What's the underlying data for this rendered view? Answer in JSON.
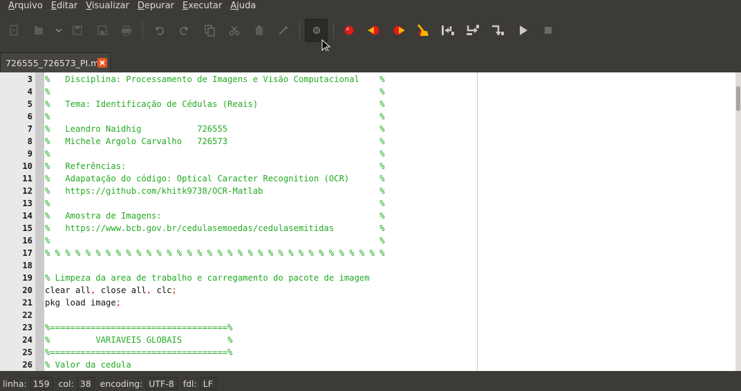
{
  "menu": {
    "items": [
      {
        "label": "Arquivo"
      },
      {
        "label": "Editar"
      },
      {
        "label": "Visualizar"
      },
      {
        "label": "Depurar"
      },
      {
        "label": "Executar"
      },
      {
        "label": "Ajuda"
      }
    ]
  },
  "tab": {
    "title": "726555_726573_PI.m",
    "close_icon": "close-icon"
  },
  "editor": {
    "lines": [
      {
        "n": "3",
        "spans": [
          {
            "t": "%   Disciplina: Processamento de Imagens e Visão Computacional    %",
            "c": "comment"
          }
        ]
      },
      {
        "n": "4",
        "spans": [
          {
            "t": "%                                                                 %",
            "c": "comment"
          }
        ]
      },
      {
        "n": "5",
        "spans": [
          {
            "t": "%   Tema: Identificação de Cédulas (Reais)                        %",
            "c": "comment"
          }
        ]
      },
      {
        "n": "6",
        "spans": [
          {
            "t": "%                                                                 %",
            "c": "comment"
          }
        ]
      },
      {
        "n": "7",
        "spans": [
          {
            "t": "%   Leandro Naidhig           726555                              %",
            "c": "comment"
          }
        ]
      },
      {
        "n": "8",
        "spans": [
          {
            "t": "%   Michele Argolo Carvalho   726573                              %",
            "c": "comment"
          }
        ]
      },
      {
        "n": "9",
        "spans": [
          {
            "t": "%                                                                 %",
            "c": "comment"
          }
        ]
      },
      {
        "n": "10",
        "spans": [
          {
            "t": "%   Referências:                                                  %",
            "c": "comment"
          }
        ]
      },
      {
        "n": "11",
        "spans": [
          {
            "t": "%   Adapatação do código: Optical Caracter Recognition (OCR)      %",
            "c": "comment"
          }
        ]
      },
      {
        "n": "12",
        "spans": [
          {
            "t": "%   https://github.com/khitk9738/OCR-Matlab                       %",
            "c": "comment"
          }
        ]
      },
      {
        "n": "13",
        "spans": [
          {
            "t": "%                                                                 %",
            "c": "comment"
          }
        ]
      },
      {
        "n": "14",
        "spans": [
          {
            "t": "%   Amostra de Imagens:                                           %",
            "c": "comment"
          }
        ]
      },
      {
        "n": "15",
        "spans": [
          {
            "t": "%   https://www.bcb.gov.br/cedulasemoedas/cedulasemitidas         %",
            "c": "comment"
          }
        ]
      },
      {
        "n": "16",
        "spans": [
          {
            "t": "%                                                                 %",
            "c": "comment"
          }
        ]
      },
      {
        "n": "17",
        "spans": [
          {
            "t": "% % % % % % % % % % % % % % % % % % % % % % % % % % % % % % % % % %",
            "c": "comment"
          }
        ]
      },
      {
        "n": "18",
        "spans": []
      },
      {
        "n": "19",
        "spans": [
          {
            "t": "% Limpeza da area de trabalho e carregamento do pacote de imagem",
            "c": "comment"
          }
        ]
      },
      {
        "n": "20",
        "spans": [
          {
            "t": "clear all",
            "c": "normal"
          },
          {
            "t": ",",
            "c": "op"
          },
          {
            "t": " close all",
            "c": "normal"
          },
          {
            "t": ",",
            "c": "op"
          },
          {
            "t": " clc",
            "c": "normal"
          },
          {
            "t": ";",
            "c": "op"
          }
        ]
      },
      {
        "n": "21",
        "spans": [
          {
            "t": "pkg load image",
            "c": "normal"
          },
          {
            "t": ";",
            "c": "op"
          }
        ]
      },
      {
        "n": "22",
        "spans": []
      },
      {
        "n": "23",
        "spans": [
          {
            "t": "%===================================%",
            "c": "comment"
          }
        ]
      },
      {
        "n": "24",
        "spans": [
          {
            "t": "%         VARIAVEIS GLOBAIS         %",
            "c": "comment"
          }
        ]
      },
      {
        "n": "25",
        "spans": [
          {
            "t": "%===================================%",
            "c": "comment"
          }
        ]
      },
      {
        "n": "26",
        "spans": [
          {
            "t": "% Valor da cedula",
            "c": "comment"
          }
        ]
      }
    ]
  },
  "status": {
    "line_label": "linha:",
    "line_value": "159",
    "col_label": "col:",
    "col_value": "38",
    "encoding_label": "encoding:",
    "encoding_value": "UTF-8",
    "eol_label": "fdl:",
    "eol_value": "LF"
  },
  "colors": {
    "comment": "#22aa22",
    "op": "#cc2200",
    "breakpoint": "#e01b1b",
    "accent": "#e95420"
  }
}
